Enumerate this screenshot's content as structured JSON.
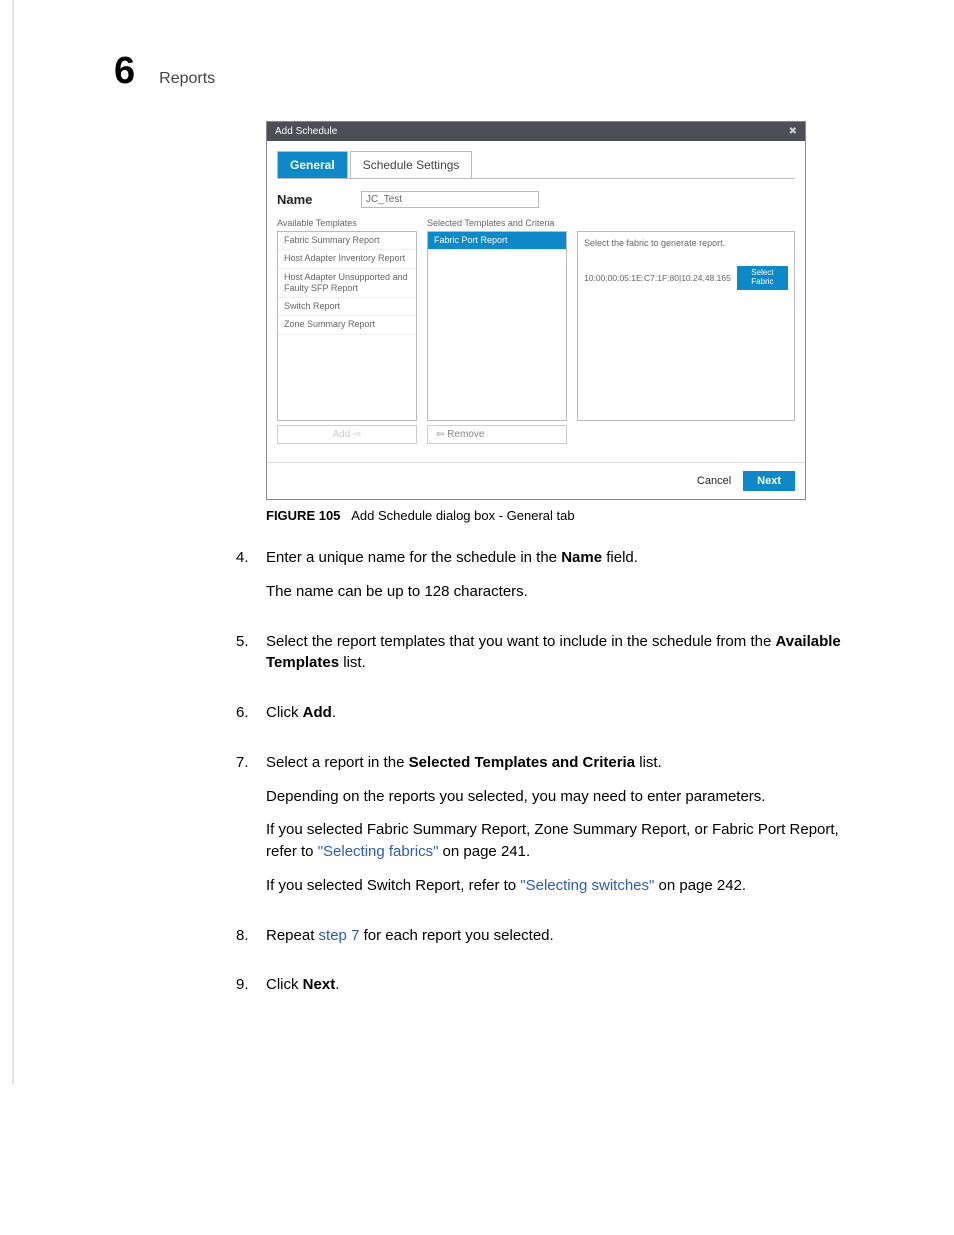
{
  "header": {
    "chapter_number": "6",
    "chapter_title": "Reports"
  },
  "dialog": {
    "title": "Add Schedule",
    "close_glyph": "✖",
    "tabs": {
      "general": "General",
      "schedule": "Schedule Settings"
    },
    "name_label": "Name",
    "name_value": "JC_Test",
    "available_heading": "Available Templates",
    "available_items": {
      "0": "Fabric Summary Report",
      "1": "Host Adapter Inventory Report",
      "2": "Host Adapter Unsupported and Faulty SFP Report",
      "3": "Switch Report",
      "4": "Zone Summary Report"
    },
    "selected_heading": "Selected Templates and Criteria",
    "selected_items": {
      "0": "Fabric Port Report"
    },
    "criteria_instruction": "Select the fabric to generate report.",
    "criteria_wwn": "10:00:00:05:1E:C7:1F:80|10.24.48.165",
    "select_fabric_label": "Select Fabric",
    "add_label": "Add ⇨",
    "remove_label": "⇦ Remove",
    "cancel_label": "Cancel",
    "next_label": "Next"
  },
  "figure": {
    "label": "FIGURE 105",
    "text": "Add Schedule dialog box - General tab"
  },
  "steps": {
    "s4_num": "4.",
    "s4_a_pre": "Enter a unique name for the schedule in the ",
    "s4_a_bold": "Name",
    "s4_a_post": " field.",
    "s4_b": "The name can be up to 128 characters.",
    "s5_num": "5.",
    "s5_pre": "Select the report templates that you want to include in the schedule from the ",
    "s5_bold": "Available Templates",
    "s5_post": " list.",
    "s6_num": "6.",
    "s6_pre": "Click ",
    "s6_bold": "Add",
    "s6_post": ".",
    "s7_num": "7.",
    "s7_a_pre": "Select a report in the ",
    "s7_a_bold": "Selected Templates and Criteria",
    "s7_a_post": " list.",
    "s7_b": "Depending on the reports you selected, you may need to enter parameters.",
    "s7_c_pre": "If you selected Fabric Summary Report, Zone Summary Report, or Fabric Port Report, refer to ",
    "s7_c_link": "\"Selecting fabrics\"",
    "s7_c_post": " on page 241.",
    "s7_d_pre": "If you selected Switch Report, refer to ",
    "s7_d_link": "\"Selecting switches\"",
    "s7_d_post": " on page 242.",
    "s8_num": "8.",
    "s8_pre": "Repeat ",
    "s8_link": "step 7",
    "s8_post": " for each report you selected.",
    "s9_num": "9.",
    "s9_pre": "Click ",
    "s9_bold": "Next",
    "s9_post": "."
  }
}
